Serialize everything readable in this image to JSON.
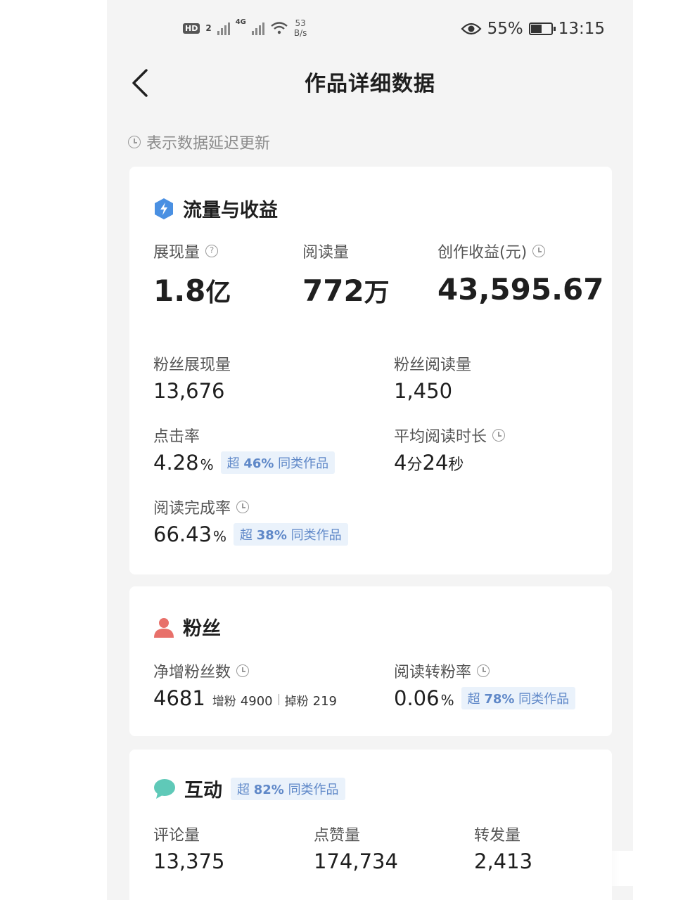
{
  "status_bar": {
    "hd": "HD",
    "sim": "2",
    "net": "4G",
    "speed_value": "53",
    "speed_unit": "B/s",
    "battery_pct": "55%",
    "battery_level": 0.55,
    "time": "13:15"
  },
  "header": {
    "title": "作品详细数据"
  },
  "notice": {
    "text": "表示数据延迟更新"
  },
  "traffic": {
    "title": "流量与收益",
    "impressions": {
      "label": "展现量",
      "value": "1.8",
      "unit": "亿"
    },
    "reads": {
      "label": "阅读量",
      "value": "772",
      "unit": "万"
    },
    "earnings": {
      "label": "创作收益(元)",
      "value": "43,595.67"
    },
    "fan_impressions": {
      "label": "粉丝展现量",
      "value": "13,676"
    },
    "fan_reads": {
      "label": "粉丝阅读量",
      "value": "1,450"
    },
    "ctr": {
      "label": "点击率",
      "value": "4.28",
      "unit": "%",
      "badge_prefix": "超",
      "badge_pct": "46%",
      "badge_suffix": "同类作品"
    },
    "avg_read_time": {
      "label": "平均阅读时长",
      "minutes": "4",
      "minutes_unit": "分",
      "seconds": "24",
      "seconds_unit": "秒"
    },
    "completion": {
      "label": "阅读完成率",
      "value": "66.43",
      "unit": "%",
      "badge_prefix": "超",
      "badge_pct": "38%",
      "badge_suffix": "同类作品"
    }
  },
  "fans": {
    "title": "粉丝",
    "net_gain": {
      "label": "净增粉丝数",
      "value": "4681",
      "gain_label": "增粉",
      "gain_value": "4900",
      "loss_label": "掉粉",
      "loss_value": "219"
    },
    "conversion": {
      "label": "阅读转粉率",
      "value": "0.06",
      "unit": "%",
      "badge_prefix": "超",
      "badge_pct": "78%",
      "badge_suffix": "同类作品"
    }
  },
  "interaction": {
    "title": "互动",
    "badge_prefix": "超",
    "badge_pct": "82%",
    "badge_suffix": "同类作品",
    "comments": {
      "label": "评论量",
      "value": "13,375"
    },
    "likes": {
      "label": "点赞量",
      "value": "174,734"
    },
    "shares": {
      "label": "转发量",
      "value": "2,413"
    }
  },
  "colors": {
    "background": "#f4f4f4",
    "card": "#ffffff",
    "traffic_icon": "#4a90e2",
    "fans_icon": "#e8706a",
    "interaction_icon": "#5fc9b8",
    "badge_text": "#5f88c8",
    "badge_bg": "#eaf2fb"
  }
}
